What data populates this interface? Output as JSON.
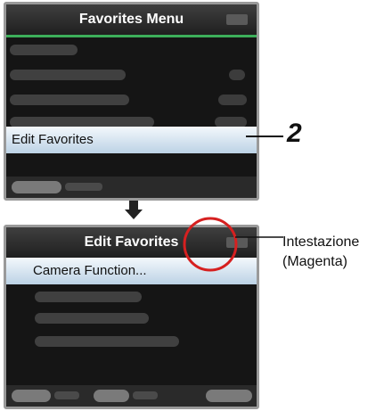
{
  "screen1": {
    "title": "Favorites Menu",
    "selected_item": "Edit Favorites",
    "header_color": "#3cae5a"
  },
  "screen2": {
    "title": "Edit Favorites",
    "selected_item": "Camera Function...",
    "header_color": "#c0117c"
  },
  "callouts": {
    "step_number": "2",
    "header_label_line1": "Intestazione",
    "header_label_line2": "(Magenta)"
  },
  "icons": {
    "arrow": "down-arrow-icon"
  }
}
